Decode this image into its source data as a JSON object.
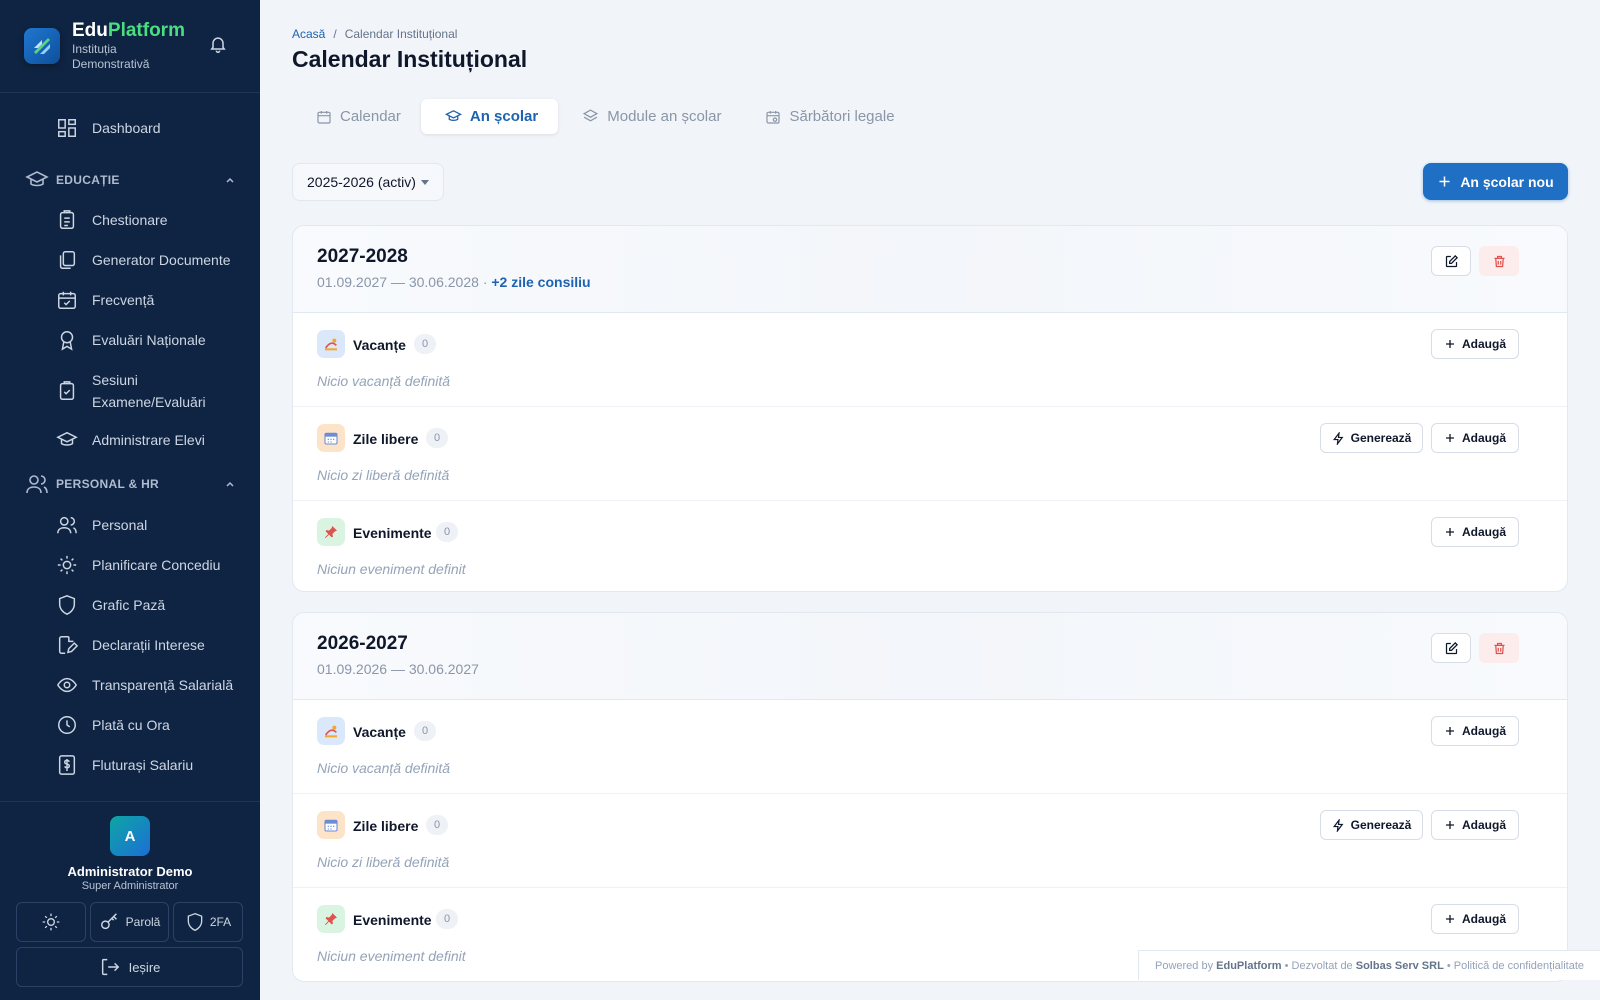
{
  "brand": {
    "name_part1": "Edu",
    "name_part2": "Platform",
    "institution": "Instituția Demonstrativă"
  },
  "sidebar": {
    "dashboard": "Dashboard",
    "sections": [
      {
        "label": "EDUCAȚIE",
        "items": [
          "Chestionare",
          "Generator Documente",
          "Frecvență",
          "Evaluări Naționale",
          "Sesiuni Examene/Evaluări",
          "Administrare Elevi"
        ]
      },
      {
        "label": "PERSONAL & HR",
        "items": [
          "Personal",
          "Planificare Concediu",
          "Grafic Pază",
          "Declarații Interese",
          "Transparență Salarială",
          "Plată cu Ora",
          "Fluturași Salariu"
        ]
      }
    ]
  },
  "user": {
    "initial": "A",
    "name": "Administrator Demo",
    "role": "Super Administrator",
    "password_label": "Parolă",
    "twofa_label": "2FA",
    "logout_label": "Ieșire"
  },
  "breadcrumb": {
    "home": "Acasă",
    "separator": "/",
    "current": "Calendar Instituțional"
  },
  "page_title": "Calendar Instituțional",
  "tabs": [
    {
      "label": "Calendar",
      "active": false
    },
    {
      "label": "An școlar",
      "active": true
    },
    {
      "label": "Module an școlar",
      "active": false
    },
    {
      "label": "Sărbători legale",
      "active": false
    }
  ],
  "year_select": {
    "value": "2025-2026 (activ)"
  },
  "new_year_button": "An școlar nou",
  "buttons": {
    "add": "Adaugă",
    "generate": "Generează"
  },
  "school_years": [
    {
      "title": "2027-2028",
      "dates": "01.09.2027 — 30.06.2028",
      "separator": "·",
      "extra": "+2 zile consiliu",
      "sections": [
        {
          "title": "Vacanțe",
          "count": "0",
          "empty": "Nicio vacanță definită"
        },
        {
          "title": "Zile libere",
          "count": "0",
          "empty": "Nicio zi liberă definită"
        },
        {
          "title": "Evenimente",
          "count": "0",
          "empty": "Niciun eveniment definit"
        }
      ]
    },
    {
      "title": "2026-2027",
      "dates": "01.09.2026 — 30.06.2027",
      "sections": [
        {
          "title": "Vacanțe",
          "count": "0",
          "empty": "Nicio vacanță definită"
        },
        {
          "title": "Zile libere",
          "count": "0",
          "empty": "Nicio zi liberă definită"
        },
        {
          "title": "Evenimente",
          "count": "0",
          "empty": "Niciun eveniment definit"
        }
      ]
    }
  ],
  "footer": {
    "powered": "Powered by",
    "brand": "EduPlatform",
    "dev_prefix": "• Dezvoltat de",
    "dev": "Solbas Serv SRL",
    "privacy": "• Politică de confidențialitate"
  },
  "colors": {
    "sidebar": "#0f2442",
    "accent": "#1f6fc4",
    "brand_green": "#4ade80",
    "danger": "#e0524d"
  }
}
